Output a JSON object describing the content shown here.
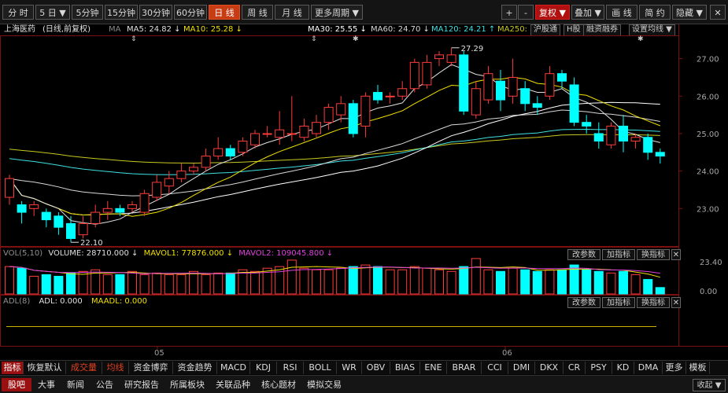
{
  "toolbar": {
    "buttons": [
      "分 时",
      "5 日 ▼",
      "5分钟",
      "15分钟",
      "30分钟",
      "60分钟",
      "日 线",
      "周 线",
      "月 线",
      "更多周期 ▼"
    ],
    "right_buttons": [
      "+",
      "-",
      "复权 ▼",
      "叠加 ▼",
      "画 线",
      "简 约",
      "隐藏 ▼"
    ],
    "close": "✕"
  },
  "info": {
    "stock": "上海医药",
    "period": "(日线,前复权)",
    "ma_label": "MA",
    "ma5": "MA5: 24.82 ↓",
    "ma10": "MA10: 25.28 ↓",
    "ma30": "MA30: 25.55 ↓",
    "ma60": "MA60: 24.70 ↓",
    "ma120": "MA120: 24.21 ↑",
    "ma250": "MA250:",
    "buttons": [
      "沪股通",
      "H股",
      "融资融券",
      "设置均线 ▼"
    ]
  },
  "colors": {
    "up": "#ff3c3c",
    "down": "#00ffff",
    "ma5": "#e0e0e0",
    "ma10": "#f0e000",
    "ma30": "#ffffff",
    "ma60": "#d8d8d8",
    "ma120": "#40e0e0",
    "ma250": "#c8c820",
    "grid": "#7a1010"
  },
  "chart_data": [
    {
      "type": "candlestick",
      "title": "上海医药 (日线,前复权)",
      "y_ticks": [
        "27.00",
        "26.00",
        "25.00",
        "24.00",
        "23.00"
      ],
      "ylim": [
        22.0,
        27.6
      ],
      "annotations": [
        {
          "label": "27.29",
          "type": "high"
        },
        {
          "label": "22.10",
          "type": "low"
        }
      ],
      "candles": [
        {
          "o": 23.3,
          "c": 23.8,
          "h": 23.9,
          "l": 23.1
        },
        {
          "o": 23.1,
          "c": 22.9,
          "h": 23.2,
          "l": 22.6
        },
        {
          "o": 23.0,
          "c": 23.1,
          "h": 23.2,
          "l": 22.8
        },
        {
          "o": 22.9,
          "c": 22.7,
          "h": 23.0,
          "l": 22.5
        },
        {
          "o": 22.8,
          "c": 22.5,
          "h": 22.9,
          "l": 22.3
        },
        {
          "o": 22.6,
          "c": 22.2,
          "h": 22.8,
          "l": 22.1
        },
        {
          "o": 22.3,
          "c": 22.6,
          "h": 22.8,
          "l": 22.2
        },
        {
          "o": 22.6,
          "c": 22.9,
          "h": 23.1,
          "l": 22.5
        },
        {
          "o": 22.9,
          "c": 23.0,
          "h": 23.2,
          "l": 22.7
        },
        {
          "o": 23.0,
          "c": 22.9,
          "h": 23.1,
          "l": 22.8
        },
        {
          "o": 23.0,
          "c": 23.1,
          "h": 23.2,
          "l": 22.9
        },
        {
          "o": 22.9,
          "c": 23.4,
          "h": 23.5,
          "l": 22.8
        },
        {
          "o": 23.3,
          "c": 23.7,
          "h": 23.9,
          "l": 23.2
        },
        {
          "o": 23.6,
          "c": 23.8,
          "h": 24.0,
          "l": 23.4
        },
        {
          "o": 23.8,
          "c": 24.0,
          "h": 24.2,
          "l": 23.7
        },
        {
          "o": 24.0,
          "c": 24.1,
          "h": 24.2,
          "l": 23.9
        },
        {
          "o": 24.1,
          "c": 24.4,
          "h": 24.6,
          "l": 24.0
        },
        {
          "o": 24.4,
          "c": 24.6,
          "h": 24.9,
          "l": 24.3
        },
        {
          "o": 24.6,
          "c": 24.4,
          "h": 24.7,
          "l": 24.3
        },
        {
          "o": 24.5,
          "c": 24.8,
          "h": 24.9,
          "l": 24.4
        },
        {
          "o": 24.7,
          "c": 25.0,
          "h": 25.1,
          "l": 24.6
        },
        {
          "o": 25.0,
          "c": 25.0,
          "h": 25.2,
          "l": 24.9
        },
        {
          "o": 24.9,
          "c": 25.1,
          "h": 25.6,
          "l": 24.7
        },
        {
          "o": 25.0,
          "c": 25.0,
          "h": 26.0,
          "l": 24.8
        },
        {
          "o": 24.9,
          "c": 25.2,
          "h": 25.4,
          "l": 24.8
        },
        {
          "o": 25.0,
          "c": 25.3,
          "h": 25.5,
          "l": 24.9
        },
        {
          "o": 25.3,
          "c": 25.7,
          "h": 25.8,
          "l": 25.1
        },
        {
          "o": 25.5,
          "c": 25.8,
          "h": 26.0,
          "l": 25.3
        },
        {
          "o": 25.8,
          "c": 25.0,
          "h": 25.9,
          "l": 24.9
        },
        {
          "o": 25.2,
          "c": 26.0,
          "h": 26.1,
          "l": 24.9
        },
        {
          "o": 26.1,
          "c": 25.9,
          "h": 26.3,
          "l": 25.8
        },
        {
          "o": 26.0,
          "c": 26.0,
          "h": 26.1,
          "l": 25.8
        },
        {
          "o": 26.0,
          "c": 26.2,
          "h": 26.4,
          "l": 25.9
        },
        {
          "o": 26.2,
          "c": 26.9,
          "h": 27.0,
          "l": 26.1
        },
        {
          "o": 26.3,
          "c": 26.9,
          "h": 27.1,
          "l": 26.2
        },
        {
          "o": 27.0,
          "c": 27.1,
          "h": 27.2,
          "l": 26.8
        },
        {
          "o": 26.9,
          "c": 27.1,
          "h": 27.29,
          "l": 26.8
        },
        {
          "o": 27.1,
          "c": 25.6,
          "h": 27.2,
          "l": 25.5
        },
        {
          "o": 25.5,
          "c": 26.2,
          "h": 26.4,
          "l": 25.4
        },
        {
          "o": 25.9,
          "c": 26.6,
          "h": 26.8,
          "l": 25.8
        },
        {
          "o": 26.4,
          "c": 25.9,
          "h": 26.7,
          "l": 25.6
        },
        {
          "o": 26.0,
          "c": 26.5,
          "h": 27.0,
          "l": 25.8
        },
        {
          "o": 26.2,
          "c": 25.8,
          "h": 26.4,
          "l": 25.6
        },
        {
          "o": 25.8,
          "c": 25.7,
          "h": 26.0,
          "l": 25.5
        },
        {
          "o": 26.0,
          "c": 26.6,
          "h": 26.8,
          "l": 25.9
        },
        {
          "o": 26.6,
          "c": 26.4,
          "h": 26.7,
          "l": 26.2
        },
        {
          "o": 26.3,
          "c": 25.3,
          "h": 26.5,
          "l": 25.2
        },
        {
          "o": 25.3,
          "c": 25.2,
          "h": 25.5,
          "l": 25.0
        },
        {
          "o": 25.0,
          "c": 24.8,
          "h": 25.3,
          "l": 24.6
        },
        {
          "o": 24.7,
          "c": 25.2,
          "h": 25.3,
          "l": 24.6
        },
        {
          "o": 25.2,
          "c": 24.8,
          "h": 25.5,
          "l": 24.5
        },
        {
          "o": 24.8,
          "c": 24.9,
          "h": 25.0,
          "l": 24.6
        },
        {
          "o": 24.9,
          "c": 24.5,
          "h": 25.0,
          "l": 24.3
        },
        {
          "o": 24.5,
          "c": 24.4,
          "h": 24.6,
          "l": 24.2
        }
      ],
      "x_labels": [
        "05",
        "06"
      ]
    },
    {
      "type": "bar",
      "title": "VOL(5,10)",
      "y_ticks": [
        "23.40",
        "0.00"
      ],
      "legend": [
        "VOLUME: 28710.000 ↓",
        "MAVOL1: 77876.000 ↓",
        "MAVOL2: 109045.800 ↓"
      ],
      "values": [
        0.85,
        0.8,
        0.55,
        0.6,
        0.55,
        0.65,
        0.7,
        0.75,
        0.6,
        0.6,
        0.7,
        0.6,
        0.65,
        0.6,
        0.6,
        0.7,
        0.6,
        0.65,
        0.65,
        0.75,
        0.7,
        0.8,
        0.85,
        1.05,
        0.8,
        0.75,
        0.75,
        0.8,
        0.85,
        0.9,
        0.85,
        0.75,
        0.75,
        0.85,
        0.8,
        0.75,
        0.7,
        0.85,
        1.1,
        0.75,
        0.7,
        0.8,
        0.75,
        0.7,
        0.75,
        0.75,
        0.9,
        0.75,
        0.7,
        0.65,
        0.7,
        0.6,
        0.45,
        0.2
      ]
    },
    {
      "type": "line",
      "title": "ADL(8)",
      "legend": [
        "ADL: 0.000",
        "MAADL: 0.000"
      ],
      "values": [
        0,
        0
      ]
    }
  ],
  "pane_buttons": [
    "改参数",
    "加指标",
    "换指标"
  ],
  "tabs": [
    "指标",
    "恢复默认",
    "成交量",
    "均线",
    "资金博弈",
    "资金趋势",
    "MACD",
    "KDJ",
    "RSI",
    "BOLL",
    "WR",
    "OBV",
    "BIAS",
    "ENE",
    "BRAR",
    "CCI",
    "DMI",
    "DKX",
    "CR",
    "PSY",
    "KD",
    "DMA",
    "更多",
    "模板"
  ],
  "bottom_tabs": [
    "股吧",
    "大事",
    "新闻",
    "公告",
    "研究报告",
    "所属板块",
    "关联品种",
    "核心题材",
    "模拟交易"
  ],
  "collapse": "收起 ▼"
}
